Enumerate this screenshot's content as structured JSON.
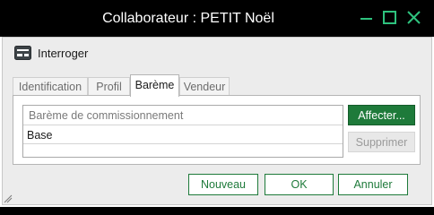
{
  "window": {
    "title": "Collaborateur : PETIT Noël"
  },
  "toolbar": {
    "interroger_label": "Interroger",
    "interroger_icon": "form-icon"
  },
  "tabs": [
    {
      "label": "Identification",
      "active": false
    },
    {
      "label": "Profil",
      "active": false
    },
    {
      "label": "Barème",
      "active": true
    },
    {
      "label": "Vendeur",
      "active": false
    }
  ],
  "bareme": {
    "column_header": "Barème de commissionnement",
    "rows": [
      "Base"
    ],
    "affecter_label": "Affecter...",
    "supprimer_label": "Supprimer"
  },
  "footer": {
    "nouveau_label": "Nouveau",
    "ok_label": "OK",
    "annuler_label": "Annuler"
  },
  "colors": {
    "accent": "#1e7a3a",
    "titlebar": "#000000",
    "window_controls": "#2ec27e"
  }
}
